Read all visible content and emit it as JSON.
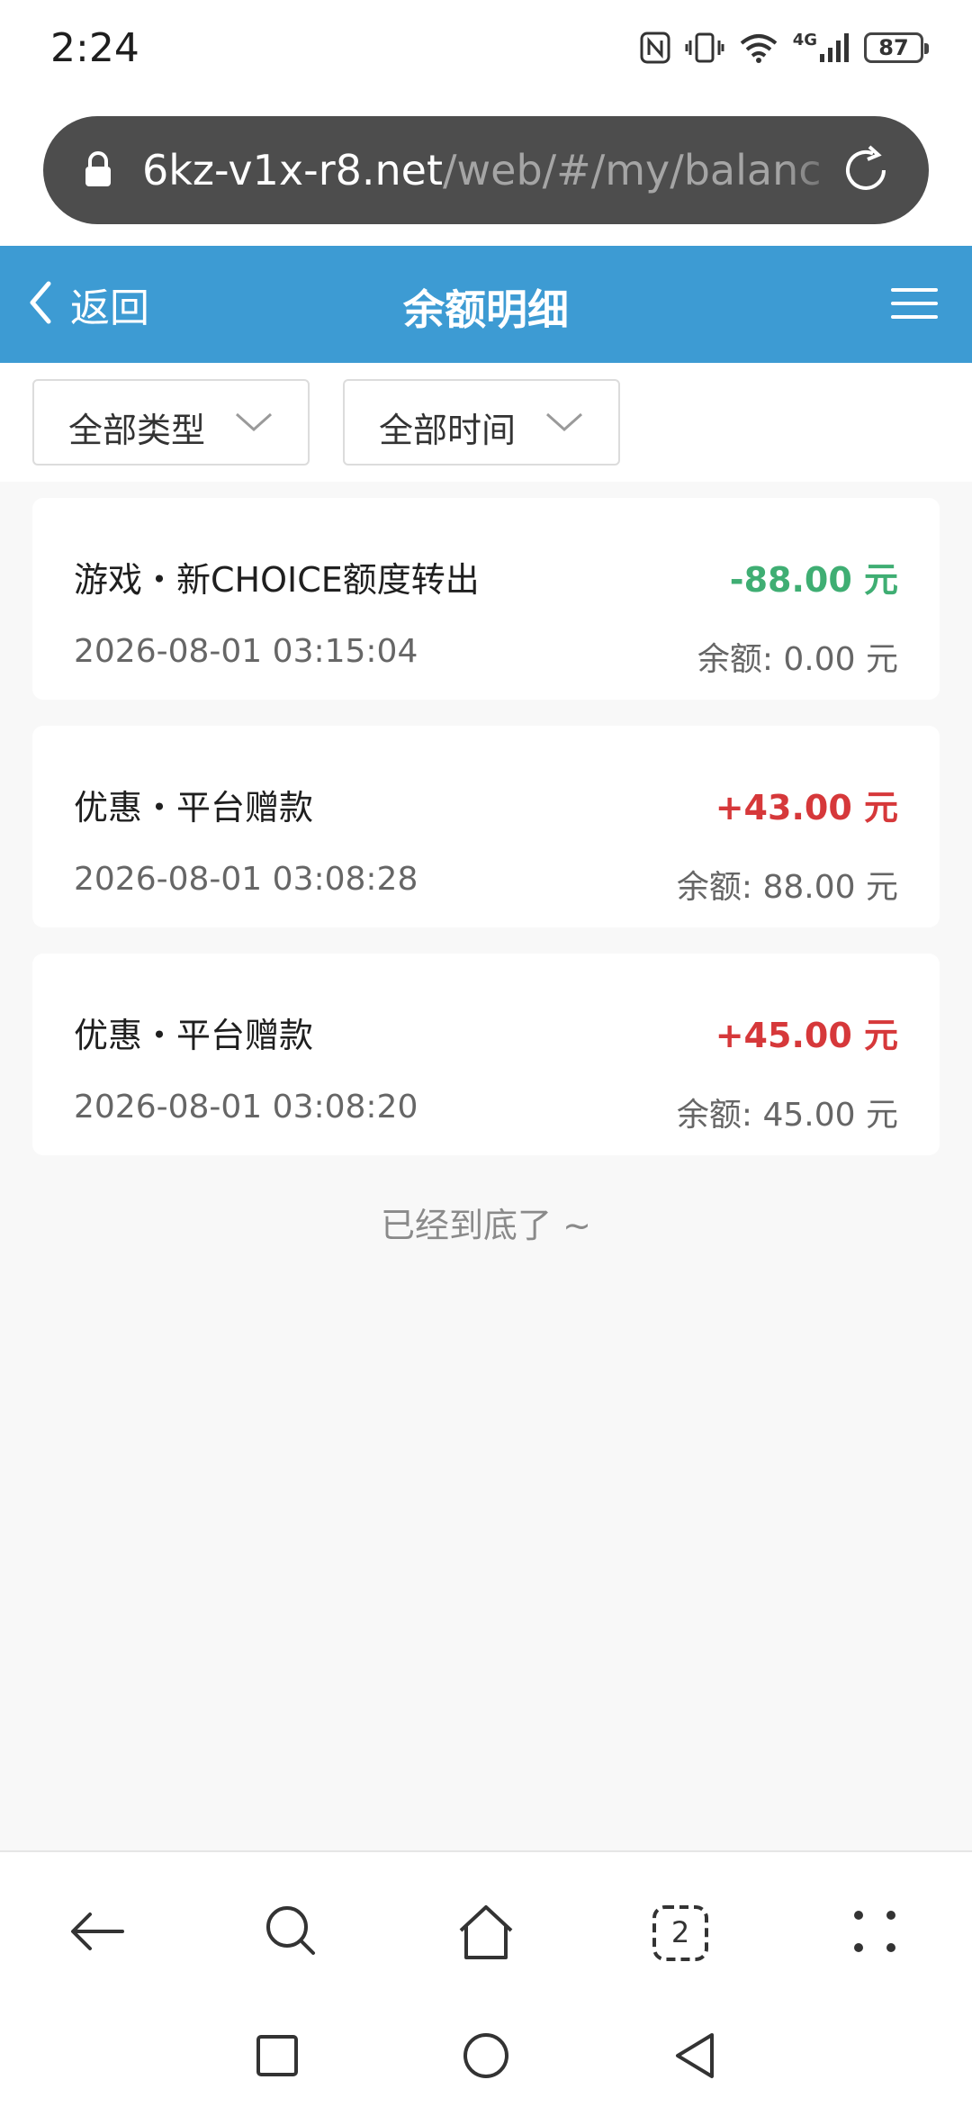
{
  "status_bar": {
    "time": "2:24",
    "icons": [
      "nfc-icon",
      "vibrate-icon",
      "wifi-icon",
      "signal-4g-icon",
      "battery-icon"
    ],
    "network_label": "4G",
    "battery": "87"
  },
  "browser": {
    "url_host": "6kz-v1x-r8.net",
    "url_path": "/web/#/my/balanc",
    "icons": [
      "lock-icon",
      "reload-icon"
    ]
  },
  "header": {
    "back_label": "返回",
    "title": "余额明细",
    "colors": {
      "background": "#3d9bd3"
    }
  },
  "filters": [
    {
      "label": "全部类型"
    },
    {
      "label": "全部时间"
    }
  ],
  "records": [
    {
      "title": "游戏・新CHOICE额度转出",
      "amount": "-88.00 元",
      "date": "2026-08-01 03:15:04",
      "balance": "余额: 0.00 元",
      "amount_color": "#3fae73"
    },
    {
      "title": "优惠・平台赠款",
      "amount": "+43.00 元",
      "date": "2026-08-01 03:08:28",
      "balance": "余额: 88.00 元",
      "amount_color": "#d6383a"
    },
    {
      "title": "优惠・平台赠款",
      "amount": "+45.00 元",
      "date": "2026-08-01 03:08:20",
      "balance": "余额: 45.00 元",
      "amount_color": "#d6383a"
    }
  ],
  "end_note": "已经到底了 ~",
  "toolbar": {
    "tab_count": "2",
    "icons": [
      "back-arrow-icon",
      "search-icon",
      "home-icon",
      "tabs-icon",
      "more-icon"
    ]
  },
  "system_nav": {
    "icons": [
      "recents-square-icon",
      "home-circle-icon",
      "back-triangle-icon"
    ]
  }
}
